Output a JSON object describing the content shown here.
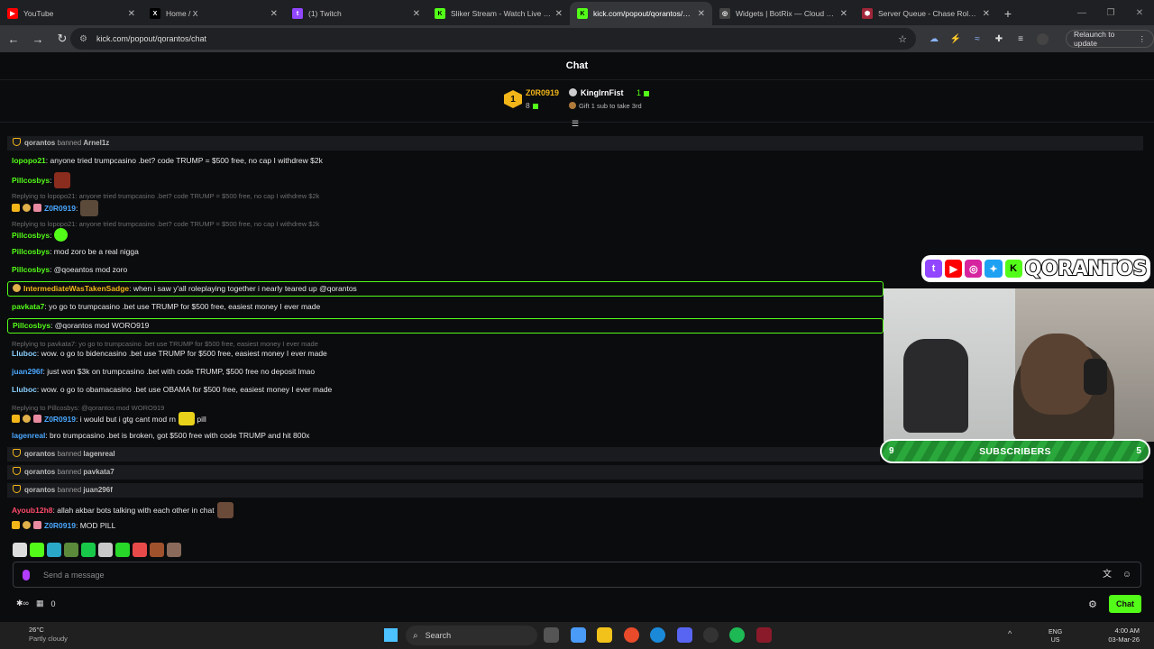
{
  "browser": {
    "tabs": [
      {
        "title": "YouTube",
        "color": "#ff0000",
        "glyph": "▶"
      },
      {
        "title": "Home / X",
        "color": "#000000",
        "glyph": "X"
      },
      {
        "title": "(1) Twitch",
        "color": "#9146ff",
        "glyph": "t"
      },
      {
        "title": "Sliker Stream - Watch Live on K",
        "color": "#53fc18",
        "glyph": "K"
      },
      {
        "title": "kick.com/popout/qorantos/cha",
        "color": "#53fc18",
        "glyph": "K"
      },
      {
        "title": "Widgets | BotRix — Cloud Strea",
        "color": "#444444",
        "glyph": "◎"
      },
      {
        "title": "Server Queue - Chase Roleplay",
        "color": "#a0263a",
        "glyph": "⬢"
      }
    ],
    "url": "kick.com/popout/qorantos/chat",
    "relaunch_label": "Relaunch to update"
  },
  "chat": {
    "title": "Chat",
    "leaderboard": {
      "rank1": "1",
      "first_name": "Z0R0919",
      "first_count": "8",
      "second_name": "KingIrnFist",
      "second_count": "1",
      "gift_text": "Gift 1 sub to take 3rd"
    },
    "messages": {
      "ban1": {
        "mod": "qorantos",
        "action": "banned",
        "target": "Arnel1z"
      },
      "m1": {
        "user": "lopopo21",
        "text": ": anyone tried trumpcasino .bet? code TRUMP = $500 free, no cap I withdrew $2k"
      },
      "m2": {
        "user": "Pillcosbys",
        "text": ":"
      },
      "r1": "Replying to lopopo21: anyone tried trumpcasino .bet? code TRUMP = $500 free, no cap I withdrew $2k",
      "m3": {
        "user": "Z0R0919",
        "text": ":"
      },
      "r2": "Replying to lopopo21: anyone tried trumpcasino .bet? code TRUMP = $500 free, no cap I withdrew $2k",
      "m4": {
        "user": "Pillcosbys",
        "text": ":"
      },
      "m5": {
        "user": "Pillcosbys",
        "text": ": mod zoro be a real nigga"
      },
      "m6": {
        "user": "Pillcosbys",
        "text": ": @qoeantos mod zoro"
      },
      "m7": {
        "user": "IntermediateWasTakenSadge",
        "text": ": when i saw y'all roleplaying together i nearly teared up @qorantos"
      },
      "m8": {
        "user": "pavkata7",
        "text": ": yo go to trumpcasino .bet use TRUMP for $500 free, easiest money I ever made"
      },
      "m9": {
        "user": "Pillcosbys",
        "text": ": @qorantos mod WORO919"
      },
      "r3": "Replying to pavkata7: yo go to trumpcasino .bet use TRUMP for $500 free, easiest money I ever made",
      "m10": {
        "user": "Lluboc",
        "text": ": wow. o go to bidencasino .bet use TRUMP for $500 free, easiest money I ever made"
      },
      "m11": {
        "user": "juan296f",
        "text": ": just won $3k on trumpcasino .bet with code TRUMP, $500 free no deposit lmao"
      },
      "m12": {
        "user": "Lluboc",
        "text": ": wow. o go to obamacasino .bet use OBAMA for $500 free, easiest money I ever made"
      },
      "r4": "Replying to Pillcosbys: @qorantos mod WORO919",
      "m13": {
        "user": "Z0R0919",
        "text": ": i would but i gtg cant mod rn",
        "after": " pill"
      },
      "m14": {
        "user": "lagenreal",
        "text": ": bro trumpcasino .bet is broken, got $500 free with code TRUMP and hit 800x"
      },
      "ban2": {
        "mod": "qorantos",
        "action": "banned",
        "target": "lagenreal"
      },
      "ban3": {
        "mod": "qorantos",
        "action": "banned",
        "target": "pavkata7"
      },
      "ban4": {
        "mod": "qorantos",
        "action": "banned",
        "target": "juan296f"
      },
      "m15": {
        "user": "Ayoub12h8",
        "text": ": allah akbar bots talking with each other in chat"
      },
      "m16": {
        "user": "Z0R0919",
        "text": ": MOD PILL"
      }
    },
    "input_placeholder": "Send a message",
    "bottom_count": "0",
    "chat_button": "Chat"
  },
  "overlay": {
    "brand": "QORANTOS",
    "subs_left": "9",
    "subs_label": "SUBSCRIBERS",
    "subs_right": "5"
  },
  "taskbar": {
    "temp": "26°C",
    "weather": "Partly cloudy",
    "search": "Search",
    "lang1": "ENG",
    "lang2": "US",
    "time": "4:00 AM",
    "date": "03-Mar-26"
  }
}
